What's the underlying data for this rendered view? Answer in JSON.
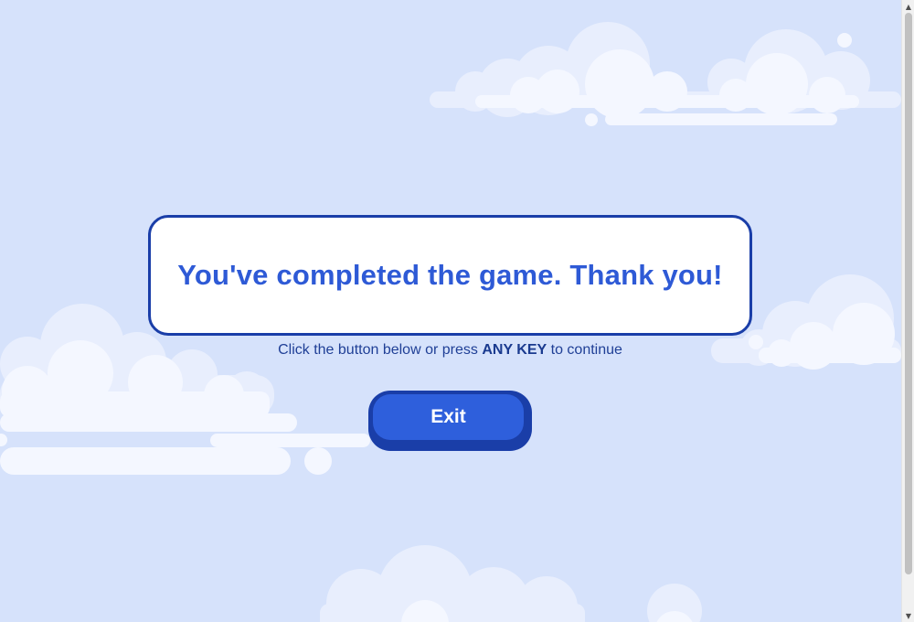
{
  "message": {
    "text": "You've completed the game. Thank you!"
  },
  "instruction": {
    "prefix": "Click the button below or press",
    "key": "ANY KEY",
    "suffix": "to continue"
  },
  "exit_button": {
    "label": "Exit"
  },
  "scrollbar": {
    "up_arrow": "▲",
    "down_arrow": "▼"
  },
  "colors": {
    "background": "#d6e2fb",
    "cloud_light": "#f4f7ff",
    "cloud_mid": "#e8eefd",
    "box_border": "#1a3ea8",
    "title_text": "#2e5ad6",
    "button_face": "#2e5fdc",
    "button_shadow": "#1a3ea8"
  }
}
